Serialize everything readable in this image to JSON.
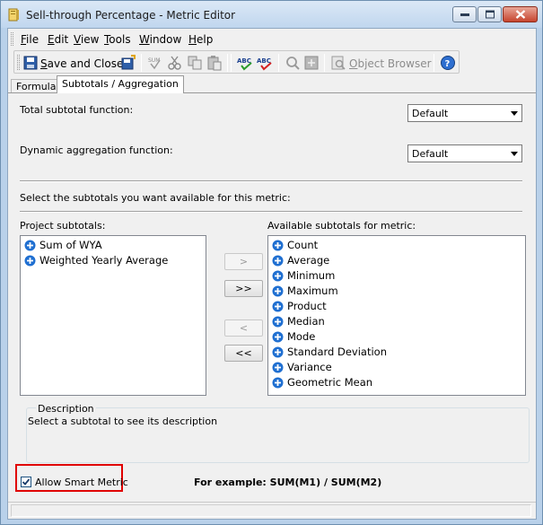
{
  "window": {
    "title": "Sell-through Percentage - Metric Editor"
  },
  "menu": {
    "items": [
      {
        "key": "F",
        "rest": "ile"
      },
      {
        "key": "E",
        "rest": "dit"
      },
      {
        "key": "V",
        "rest": "iew"
      },
      {
        "key": "T",
        "rest": "ools"
      },
      {
        "key": "W",
        "rest": "indow"
      },
      {
        "key": "H",
        "rest": "elp"
      }
    ]
  },
  "toolbar": {
    "save_close_key": "S",
    "save_close_rest": "ave and Close",
    "object_browser_key": "O",
    "object_browser_rest": "bject Browser"
  },
  "tabs": [
    {
      "label": "Formula",
      "active": false
    },
    {
      "label": "Subtotals / Aggregation",
      "active": true
    }
  ],
  "subtotals": {
    "total_label": "Total subtotal function:",
    "total_value": "Default",
    "dynamic_label": "Dynamic aggregation function:",
    "dynamic_value": "Default",
    "instruction": "Select the subtotals you want available for this metric:",
    "project_label": "Project subtotals:",
    "available_label": "Available subtotals for metric:",
    "project_items": [
      "Sum of WYA",
      "Weighted Yearly Average"
    ],
    "available_items": [
      "Count",
      "Average",
      "Minimum",
      "Maximum",
      "Product",
      "Median",
      "Mode",
      "Standard Deviation",
      "Variance",
      "Geometric Mean"
    ],
    "buttons": {
      "add": ">",
      "add_all": ">>",
      "remove": "<",
      "remove_all": "<<"
    }
  },
  "description": {
    "legend": "Description",
    "text": "Select a subtotal to see its description"
  },
  "smart_metric": {
    "label": "Allow Smart Metric",
    "checked": true,
    "example": "For example: SUM(M1) / SUM(M2)"
  },
  "colors": {
    "highlight": "#e00000",
    "plus_icon": "#1f6fd1"
  }
}
